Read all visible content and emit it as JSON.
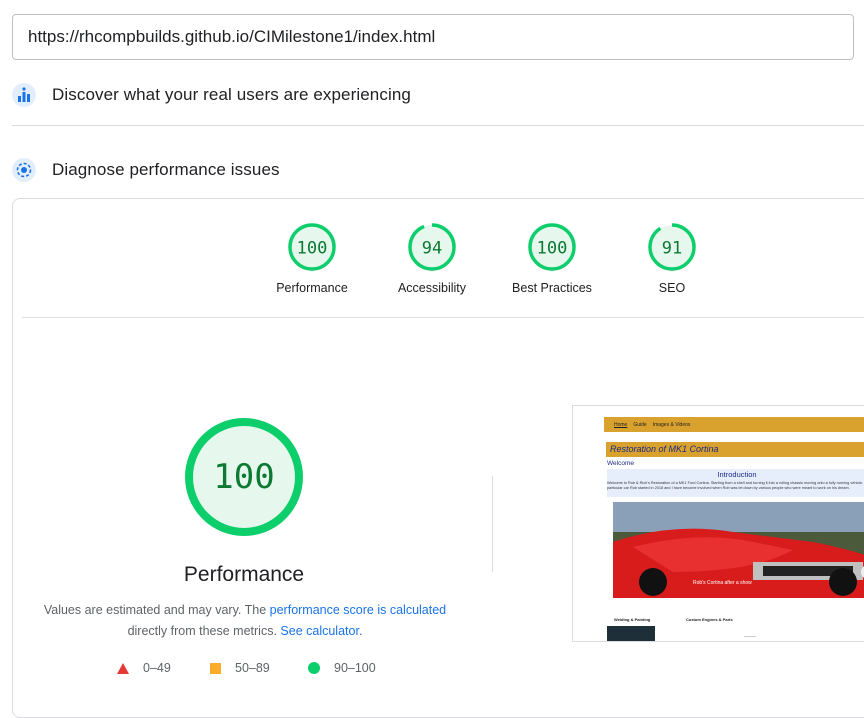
{
  "url_bar": {
    "value": "https://rhcompbuilds.github.io/CIMilestone1/index.html"
  },
  "sections": {
    "real_users": {
      "label": "Discover what your real users are experiencing",
      "icon": "crux-chart-icon"
    },
    "diagnose": {
      "label": "Diagnose performance issues",
      "icon": "lighthouse-icon"
    }
  },
  "scores": [
    {
      "label": "Performance",
      "score": 100
    },
    {
      "label": "Accessibility",
      "score": 94
    },
    {
      "label": "Best Practices",
      "score": 100
    },
    {
      "label": "SEO",
      "score": 91
    }
  ],
  "main_gauge": {
    "score": "100",
    "label": "Performance"
  },
  "description": {
    "text1": "Values are estimated and may vary. The ",
    "link1": "performance score is calculated",
    "text2": "directly from these metrics. ",
    "link2": "See calculator",
    "text3": "."
  },
  "legend": [
    {
      "range": "0–49",
      "shape": "triangle",
      "color": "#e53935"
    },
    {
      "range": "50–89",
      "shape": "square",
      "color": "#fbab2a"
    },
    {
      "range": "90–100",
      "shape": "circle",
      "color": "#0cce6b"
    }
  ],
  "colors": {
    "pass_ring": "#0cce6b",
    "pass_fill": "#e6f8ee",
    "pass_text": "#0c7a32",
    "link": "#1a73e8"
  },
  "screenshot": {
    "nav_items": [
      "Home",
      "Guide",
      "Images & Videos"
    ],
    "title": "Restoration of MK1 Cortina",
    "welcome": "Welcome",
    "intro": "Introduction",
    "paragraph": "Welcome to Rob & Rich's Restoration of a MK1 Ford Cortina. Starting from a shell and turning it into a rolling chassis moving onto a fully running vehicle. This particular car Rob started in 2018 and I have become involved when Rob was let down by various people who were meant to work on his dream.",
    "caption": "Rob's Cortina after a show",
    "sub1": "Welding & Painting",
    "sub2": "Custom Engines & Parts"
  }
}
